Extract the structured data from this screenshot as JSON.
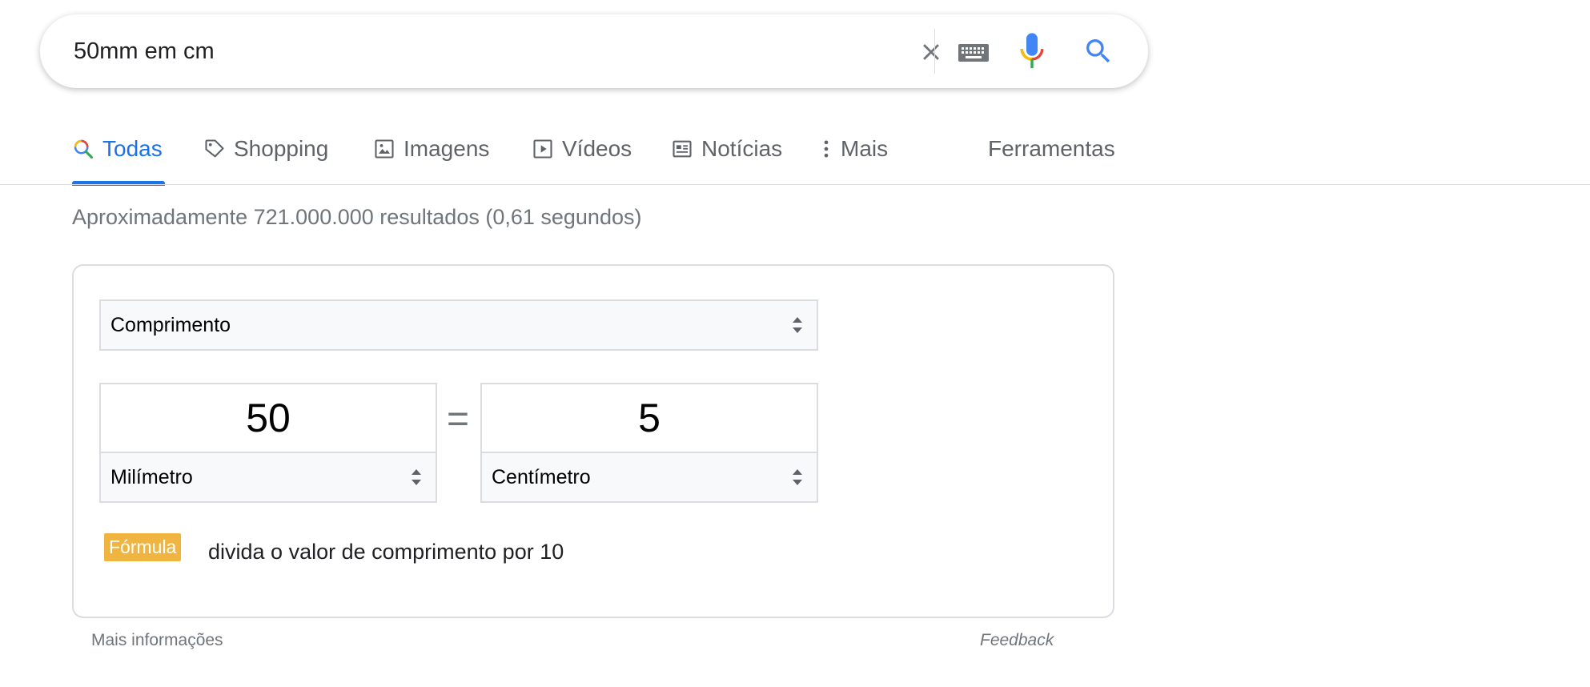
{
  "search": {
    "query": "50mm em cm",
    "icons": {
      "clear": "close-icon",
      "keyboard": "keyboard-icon",
      "voice": "microphone-icon",
      "submit": "search-icon"
    }
  },
  "tabs": [
    {
      "label": "Todas",
      "icon": "search-icon",
      "active": true
    },
    {
      "label": "Shopping",
      "icon": "tag-icon",
      "active": false
    },
    {
      "label": "Imagens",
      "icon": "image-icon",
      "active": false
    },
    {
      "label": "Vídeos",
      "icon": "play-icon",
      "active": false
    },
    {
      "label": "Notícias",
      "icon": "newspaper-icon",
      "active": false
    },
    {
      "label": "Mais",
      "icon": "more-vert-icon",
      "active": false
    }
  ],
  "tools_label": "Ferramentas",
  "result_stats": "Aproximadamente 721.000.000 resultados (0,61 segundos)",
  "converter": {
    "category": "Comprimento",
    "from": {
      "value": "50",
      "unit": "Milímetro"
    },
    "equals": "=",
    "to": {
      "value": "5",
      "unit": "Centímetro"
    },
    "formula_badge": "Fórmula",
    "formula_text": "divida o valor de comprimento por 10"
  },
  "footer": {
    "more_info": "Mais informações",
    "feedback": "Feedback"
  },
  "colors": {
    "accent": "#1a73e8",
    "formula_badge": "#f0b440",
    "muted_text": "#70757a"
  }
}
